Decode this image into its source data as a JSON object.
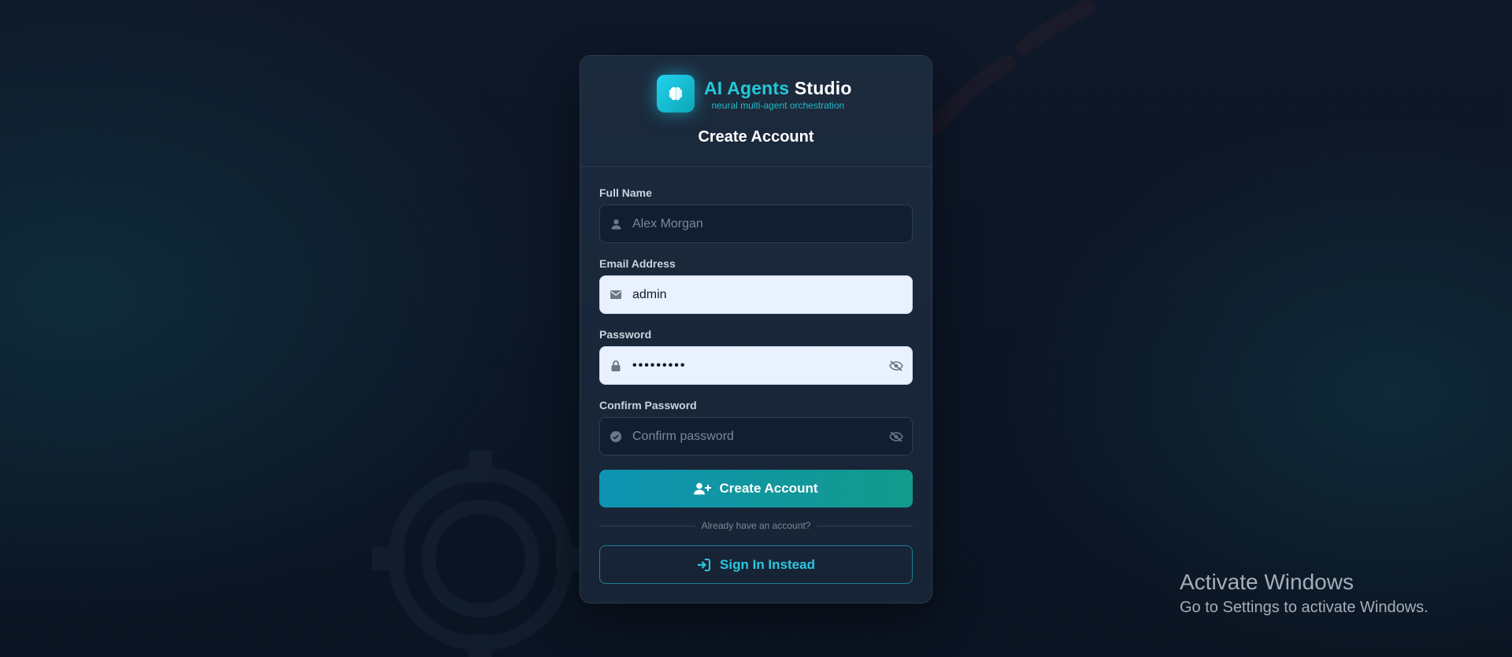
{
  "brand": {
    "name_part1": "AI Agents",
    "name_part2": "Studio",
    "tagline": "neural multi-agent orchestration"
  },
  "form": {
    "title": "Create Account",
    "fields": {
      "full_name": {
        "label": "Full Name",
        "placeholder": "Alex Morgan",
        "value": ""
      },
      "email": {
        "label": "Email Address",
        "placeholder": "",
        "value": "admin"
      },
      "password": {
        "label": "Password",
        "value_masked": "•••••••••"
      },
      "confirm_password": {
        "label": "Confirm Password",
        "placeholder": "Confirm password",
        "value": ""
      }
    },
    "submit_label": "Create Account",
    "divider_text": "Already have an account?",
    "signin_label": "Sign In Instead"
  },
  "watermark": {
    "line1": "Activate Windows",
    "line2": "Go to Settings to activate Windows."
  },
  "colors": {
    "accent": "#22c9d8",
    "primary_gradient_start": "#0e93b3",
    "primary_gradient_end": "#139b8c",
    "card_bg": "#1c2a3d"
  },
  "icons": {
    "logo": "brain-icon",
    "full_name": "user-icon",
    "email": "envelope-icon",
    "password": "lock-icon",
    "confirm_password": "check-circle-icon",
    "toggle": "eye-slash-icon",
    "submit": "user-plus-icon",
    "signin": "sign-in-icon"
  }
}
